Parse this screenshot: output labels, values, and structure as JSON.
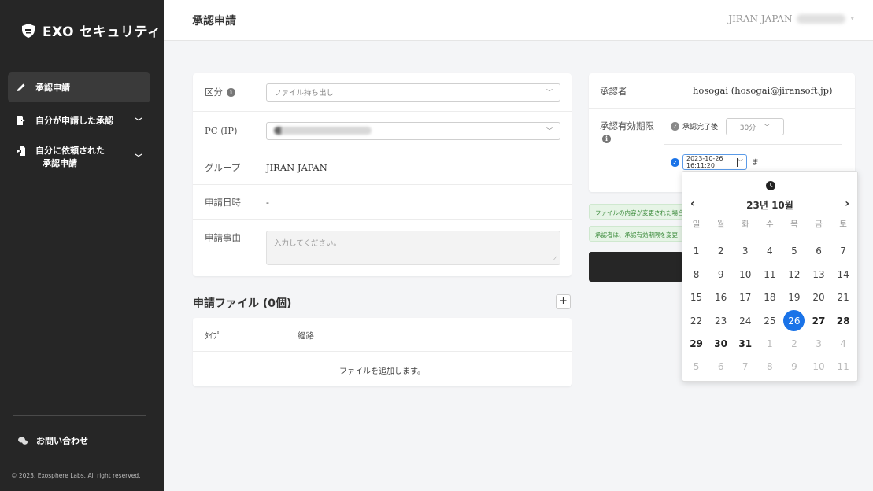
{
  "app": {
    "logo_text": "EXO セキュリティ"
  },
  "sidebar": {
    "items": [
      {
        "label": "承認申請"
      },
      {
        "label": "自分が申請した承認"
      },
      {
        "label_line1": "自分に依頼された",
        "label_line2": "承認申請"
      }
    ],
    "contact": "お問い合わせ",
    "copyright": "© 2023. Exosphere Labs. All right reserved."
  },
  "header": {
    "title": "承認申請",
    "company": "JIRAN JAPAN"
  },
  "form": {
    "category_label": "区分",
    "category_value": "ファイル持ち出し",
    "pc_label": "PC (IP)",
    "group_label": "グループ",
    "group_value": "JIRAN JAPAN",
    "date_label": "申請日時",
    "date_value": "-",
    "reason_label": "申請事由",
    "reason_placeholder": "入力してください。"
  },
  "files": {
    "title": "申請ファイル (0個)",
    "add_label": "+",
    "col_type": "ﾀｲﾌﾟ",
    "col_path": "経路",
    "empty": "ファイルを追加します。"
  },
  "approver": {
    "label": "承認者",
    "value": "hosogai (hosogai@jiransoft.jp)",
    "validity_label": "承認有効期限",
    "option1": "承認完了後",
    "option1_select": "30分",
    "datetime": "2023-10-26 16:11:20",
    "until": "ま"
  },
  "notices": [
    "ファイルの内容が変更された場合",
    "承認者は、承認有効期限を変更"
  ],
  "calendar": {
    "title": "23년 10월",
    "prev": "‹",
    "next": "›",
    "weekdays": [
      "일",
      "월",
      "화",
      "수",
      "목",
      "금",
      "토"
    ],
    "weeks": [
      [
        "1",
        "2",
        "3",
        "4",
        "5",
        "6",
        "7"
      ],
      [
        "8",
        "9",
        "10",
        "11",
        "12",
        "13",
        "14"
      ],
      [
        "15",
        "16",
        "17",
        "18",
        "19",
        "20",
        "21"
      ],
      [
        "22",
        "23",
        "24",
        "25",
        "26",
        "27",
        "28"
      ],
      [
        "29",
        "30",
        "31",
        "1",
        "2",
        "3",
        "4"
      ],
      [
        "5",
        "6",
        "7",
        "8",
        "9",
        "10",
        "11"
      ]
    ]
  }
}
